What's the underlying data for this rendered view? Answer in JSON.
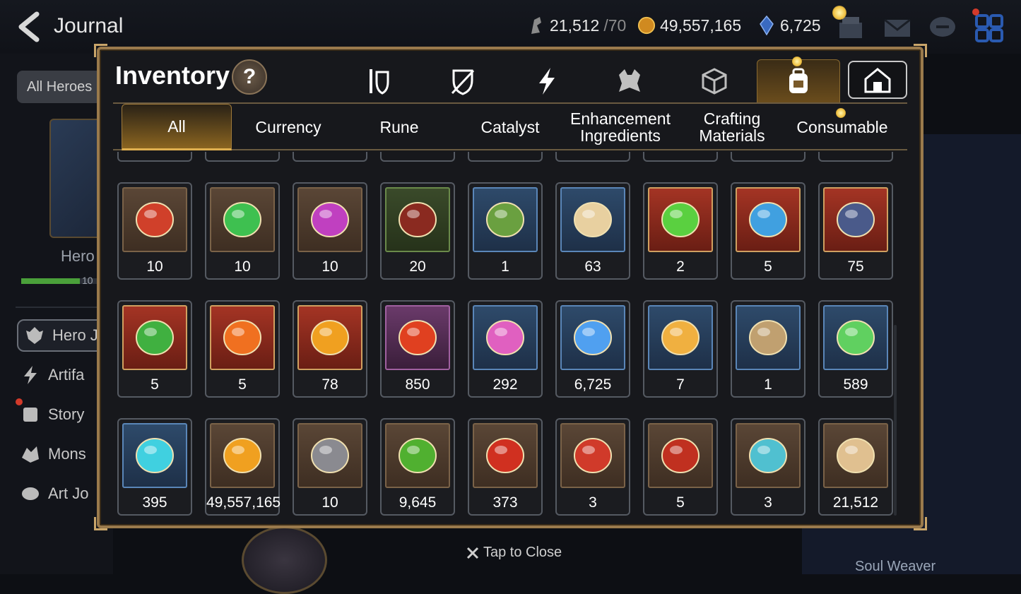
{
  "header": {
    "title": "Journal",
    "stamina": {
      "value": "21,512",
      "max": "/70"
    },
    "gold": "49,557,165",
    "crystals": "6,725"
  },
  "sidebar": {
    "all_heroes_label": "All Heroes",
    "hero_label": "Hero",
    "hero_count": "10",
    "hero_progress": 0.75,
    "items": [
      {
        "label": "Hero J",
        "icon": "hero-icon"
      },
      {
        "label": "Artifa",
        "icon": "artifact-icon"
      },
      {
        "label": "Story",
        "icon": "story-icon"
      },
      {
        "label": "Mons",
        "icon": "monster-icon"
      },
      {
        "label": "Art Jo",
        "icon": "art-icon"
      }
    ]
  },
  "right_panel": {
    "label": "Soul Weaver"
  },
  "modal": {
    "title": "Inventory",
    "help_label": "?",
    "category_tabs": [
      {
        "name": "equipment-tab",
        "icon": "armor-icon"
      },
      {
        "name": "artifact-tab",
        "icon": "shield-icon"
      },
      {
        "name": "skill-tab",
        "icon": "lightning-icon"
      },
      {
        "name": "monster-tab",
        "icon": "beast-icon"
      },
      {
        "name": "material-tab",
        "icon": "cube-icon"
      },
      {
        "name": "items-tab",
        "icon": "backpack-icon",
        "selected": true
      },
      {
        "name": "storage-tab",
        "icon": "house-icon"
      }
    ],
    "filters": [
      "All",
      "Currency",
      "Rune",
      "Catalyst",
      "Enhancement Ingredients",
      "Crafting Materials",
      "Consumable"
    ],
    "active_filter": "All",
    "items": [
      {
        "qty": "10",
        "frame": "brown",
        "icon": "red-rune-icon",
        "color": "#d0402a"
      },
      {
        "qty": "10",
        "frame": "brown",
        "icon": "green-rune-icon",
        "color": "#3ec050"
      },
      {
        "qty": "10",
        "frame": "brown",
        "icon": "purple-rune-icon",
        "color": "#c040c0"
      },
      {
        "qty": "20",
        "frame": "green",
        "icon": "claw-icon",
        "color": "#8a2a20"
      },
      {
        "qty": "1",
        "frame": "blue",
        "icon": "leaf-pile-icon",
        "color": "#6aa040"
      },
      {
        "qty": "63",
        "frame": "blue",
        "icon": "root-icon",
        "color": "#e8d0a0"
      },
      {
        "qty": "2",
        "frame": "red",
        "icon": "green-orb-icon",
        "color": "#5ad040"
      },
      {
        "qty": "5",
        "frame": "red",
        "icon": "blue-charm-icon",
        "color": "#40a0e0"
      },
      {
        "qty": "75",
        "frame": "red",
        "icon": "ring-charm-icon",
        "color": "#4a5a8a"
      },
      {
        "qty": "5",
        "frame": "red",
        "icon": "clover-charm-icon",
        "color": "#40b040"
      },
      {
        "qty": "5",
        "frame": "red",
        "icon": "flame-charm-icon",
        "color": "#f07020"
      },
      {
        "qty": "78",
        "frame": "red",
        "icon": "crystal-shard-icon",
        "color": "#f0a020"
      },
      {
        "qty": "850",
        "frame": "purple",
        "icon": "red-ring-icon",
        "color": "#e04020"
      },
      {
        "qty": "292",
        "frame": "blue",
        "icon": "pink-gem-pile-icon",
        "color": "#e060c0"
      },
      {
        "qty": "6,725",
        "frame": "blue",
        "icon": "blue-crystal-icon",
        "color": "#50a0f0"
      },
      {
        "qty": "7",
        "frame": "blue",
        "icon": "star-compass-icon",
        "color": "#f0b040"
      },
      {
        "qty": "1",
        "frame": "blue",
        "icon": "dagger-pendant-icon",
        "color": "#c0a070"
      },
      {
        "qty": "589",
        "frame": "blue",
        "icon": "green-leaf-icon",
        "color": "#60d060"
      },
      {
        "qty": "395",
        "frame": "blue",
        "icon": "cyan-crystal-icon",
        "color": "#40d0e0"
      },
      {
        "qty": "49,557,165",
        "frame": "brown",
        "icon": "gold-coin-icon",
        "color": "#f0a020"
      },
      {
        "qty": "10",
        "frame": "brown",
        "icon": "stone-compass-icon",
        "color": "#8a8a90"
      },
      {
        "qty": "9,645",
        "frame": "brown",
        "icon": "green-heart-icon",
        "color": "#50b030"
      },
      {
        "qty": "373",
        "frame": "brown",
        "icon": "red-leaf-icon",
        "color": "#d03020"
      },
      {
        "qty": "3",
        "frame": "brown",
        "icon": "red-badge-icon",
        "color": "#d03a2a"
      },
      {
        "qty": "5",
        "frame": "brown",
        "icon": "banner-icon",
        "color": "#c03020"
      },
      {
        "qty": "3",
        "frame": "brown",
        "icon": "pet-charm-icon",
        "color": "#50c0d0"
      },
      {
        "qty": "21,512",
        "frame": "brown",
        "icon": "knight-chess-icon",
        "color": "#e0c090"
      }
    ],
    "partial_row_label": "…"
  },
  "footer": {
    "tap_to_close": "Tap to Close"
  }
}
